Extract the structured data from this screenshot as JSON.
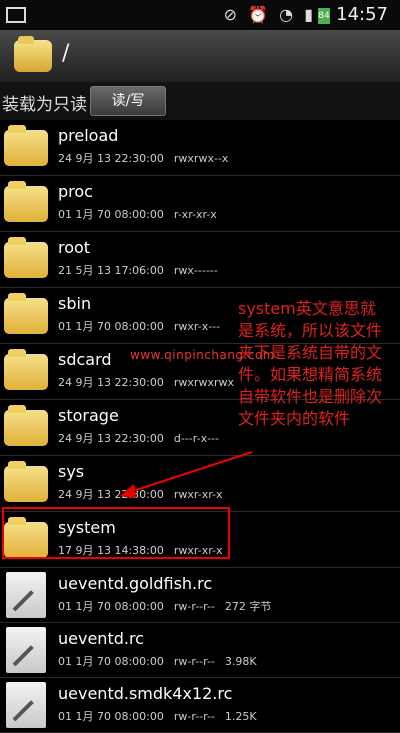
{
  "status_bar": {
    "time": "14:57",
    "battery": "84"
  },
  "title_bar": {
    "path": "/"
  },
  "mode_bar": {
    "label": "装载为只读",
    "button": "读/写"
  },
  "items": [
    {
      "name": "preload",
      "date": "24 9月 13 22:30:00",
      "perm": "rwxrwx--x",
      "size": "",
      "kind": "folder"
    },
    {
      "name": "proc",
      "date": "01 1月 70 08:00:00",
      "perm": "r-xr-xr-x",
      "size": "",
      "kind": "folder"
    },
    {
      "name": "root",
      "date": "21 5月 13 17:06:00",
      "perm": "rwx------",
      "size": "",
      "kind": "folder"
    },
    {
      "name": "sbin",
      "date": "01 1月 70 08:00:00",
      "perm": "rwxr-x---",
      "size": "",
      "kind": "folder"
    },
    {
      "name": "sdcard",
      "date": "24 9月 13 22:30:00",
      "perm": "rwxrwxrwx",
      "size": "",
      "kind": "folder"
    },
    {
      "name": "storage",
      "date": "24 9月 13 22:30:00",
      "perm": "d---r-x---",
      "size": "",
      "kind": "folder"
    },
    {
      "name": "sys",
      "date": "24 9月 13 22:30:00",
      "perm": "rwxr-xr-x",
      "size": "",
      "kind": "folder"
    },
    {
      "name": "system",
      "date": "17 9月 13 14:38:00",
      "perm": "rwxr-xr-x",
      "size": "",
      "kind": "folder"
    },
    {
      "name": "ueventd.goldfish.rc",
      "date": "01 1月 70 08:00:00",
      "perm": "rw-r--r--",
      "size": "272 字节",
      "kind": "file"
    },
    {
      "name": "ueventd.rc",
      "date": "01 1月 70 08:00:00",
      "perm": "rw-r--r--",
      "size": "3.98K",
      "kind": "file"
    },
    {
      "name": "ueventd.smdk4x12.rc",
      "date": "01 1月 70 08:00:00",
      "perm": "rw-r--r--",
      "size": "1.25K",
      "kind": "file"
    }
  ],
  "annotation": "system英文意思就是系统，所以该文件夹下是系统自带的文件。如果想精简系统自带软件也是删除次文件夹内的软件",
  "watermark": "www.qinpinchang.com"
}
